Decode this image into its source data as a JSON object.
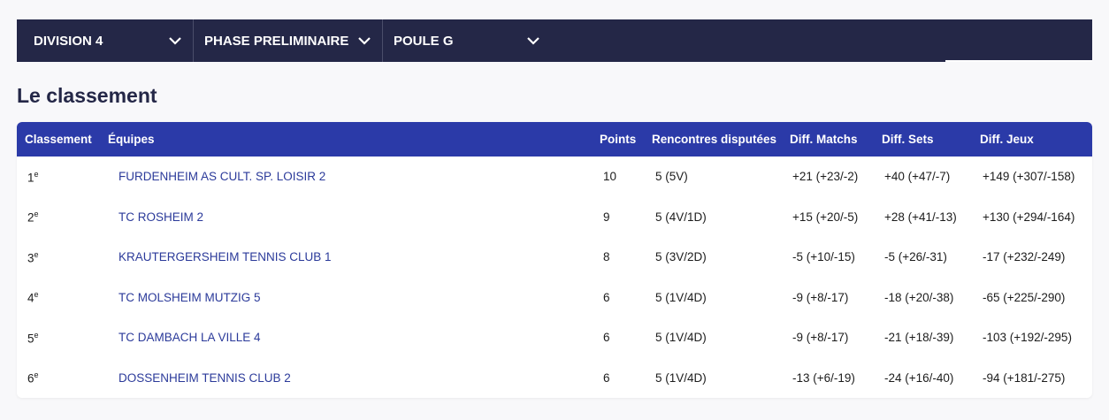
{
  "filters": [
    {
      "label": "DIVISION 4"
    },
    {
      "label": "PHASE PRELIMINAIRE"
    },
    {
      "label": "POULE G"
    }
  ],
  "section_title": "Le classement",
  "table": {
    "headers": [
      "Classement",
      "Équipes",
      "Points",
      "Rencontres disputées",
      "Diff. Matchs",
      "Diff. Sets",
      "Diff. Jeux"
    ],
    "rank_suffix": "e",
    "rows": [
      {
        "rank": "1",
        "team": "FURDENHEIM AS CULT. SP. LOISIR 2",
        "points": "10",
        "rencontres": "5 (5V)",
        "diff_matchs": "+21 (+23/-2)",
        "diff_sets": "+40 (+47/-7)",
        "diff_jeux": "+149 (+307/-158)"
      },
      {
        "rank": "2",
        "team": "TC ROSHEIM 2",
        "points": "9",
        "rencontres": "5 (4V/1D)",
        "diff_matchs": "+15 (+20/-5)",
        "diff_sets": "+28 (+41/-13)",
        "diff_jeux": "+130 (+294/-164)"
      },
      {
        "rank": "3",
        "team": "KRAUTERGERSHEIM TENNIS CLUB 1",
        "points": "8",
        "rencontres": "5 (3V/2D)",
        "diff_matchs": "-5 (+10/-15)",
        "diff_sets": "-5 (+26/-31)",
        "diff_jeux": "-17 (+232/-249)"
      },
      {
        "rank": "4",
        "team": "TC MOLSHEIM MUTZIG 5",
        "points": "6",
        "rencontres": "5 (1V/4D)",
        "diff_matchs": "-9 (+8/-17)",
        "diff_sets": "-18 (+20/-38)",
        "diff_jeux": "-65 (+225/-290)"
      },
      {
        "rank": "5",
        "team": "TC DAMBACH LA VILLE 4",
        "points": "6",
        "rencontres": "5 (1V/4D)",
        "diff_matchs": "-9 (+8/-17)",
        "diff_sets": "-21 (+18/-39)",
        "diff_jeux": "-103 (+192/-295)"
      },
      {
        "rank": "6",
        "team": "DOSSENHEIM TENNIS CLUB 2",
        "points": "6",
        "rencontres": "5 (1V/4D)",
        "diff_matchs": "-13 (+6/-19)",
        "diff_sets": "-24 (+16/-40)",
        "diff_jeux": "-94 (+181/-275)"
      }
    ]
  },
  "colors": {
    "filter_bar": "#242747",
    "table_header": "#2b3aa8",
    "team_link": "#2b3a9a"
  }
}
